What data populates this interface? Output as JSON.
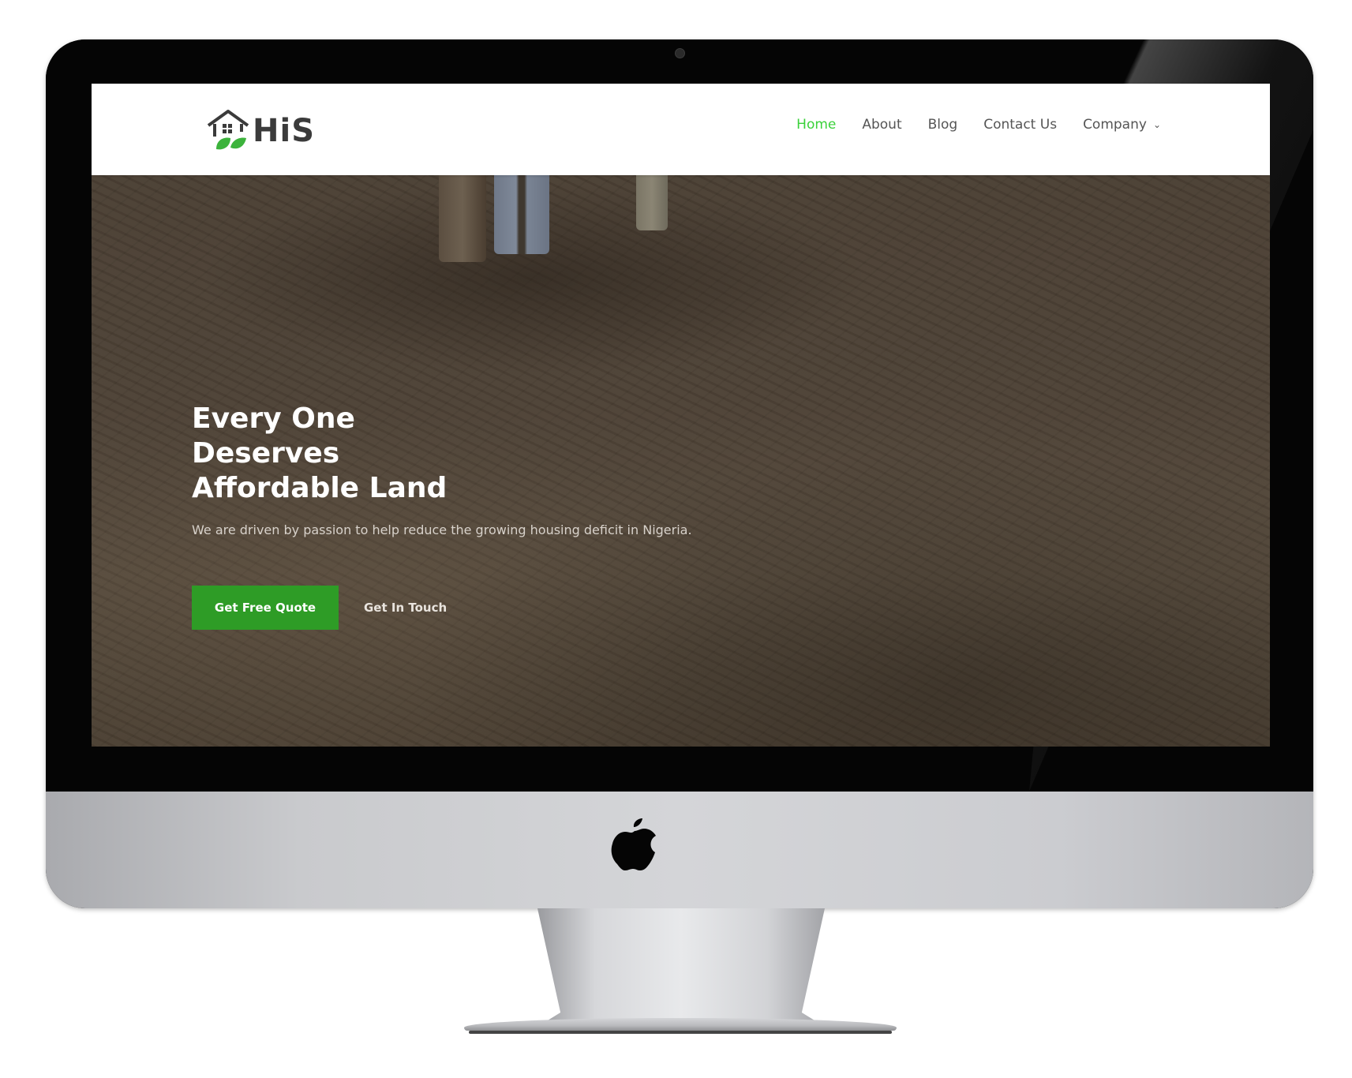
{
  "site": {
    "logo_text": "HiS",
    "nav": [
      {
        "label": "Home",
        "active": true
      },
      {
        "label": "About",
        "active": false
      },
      {
        "label": "Blog",
        "active": false
      },
      {
        "label": "Contact Us",
        "active": false
      },
      {
        "label": "Company",
        "active": false,
        "has_dropdown": true
      }
    ],
    "hero": {
      "title_lines": [
        "Every One",
        "Deserves",
        "Affordable Land"
      ],
      "subtitle": "We are driven by passion to help reduce the growing housing deficit in Nigeria.",
      "primary_button": "Get Free Quote",
      "secondary_button": "Get In Touch"
    }
  },
  "colors": {
    "accent_green": "#2e9c26",
    "nav_active": "#3ad13a",
    "logo_leaf": "#3cb33c"
  },
  "icons": {
    "device": "imac-frame",
    "brand": "apple-logo-icon",
    "nav_dropdown": "chevron-down-icon",
    "logo_mark": "house-leaf-icon"
  }
}
